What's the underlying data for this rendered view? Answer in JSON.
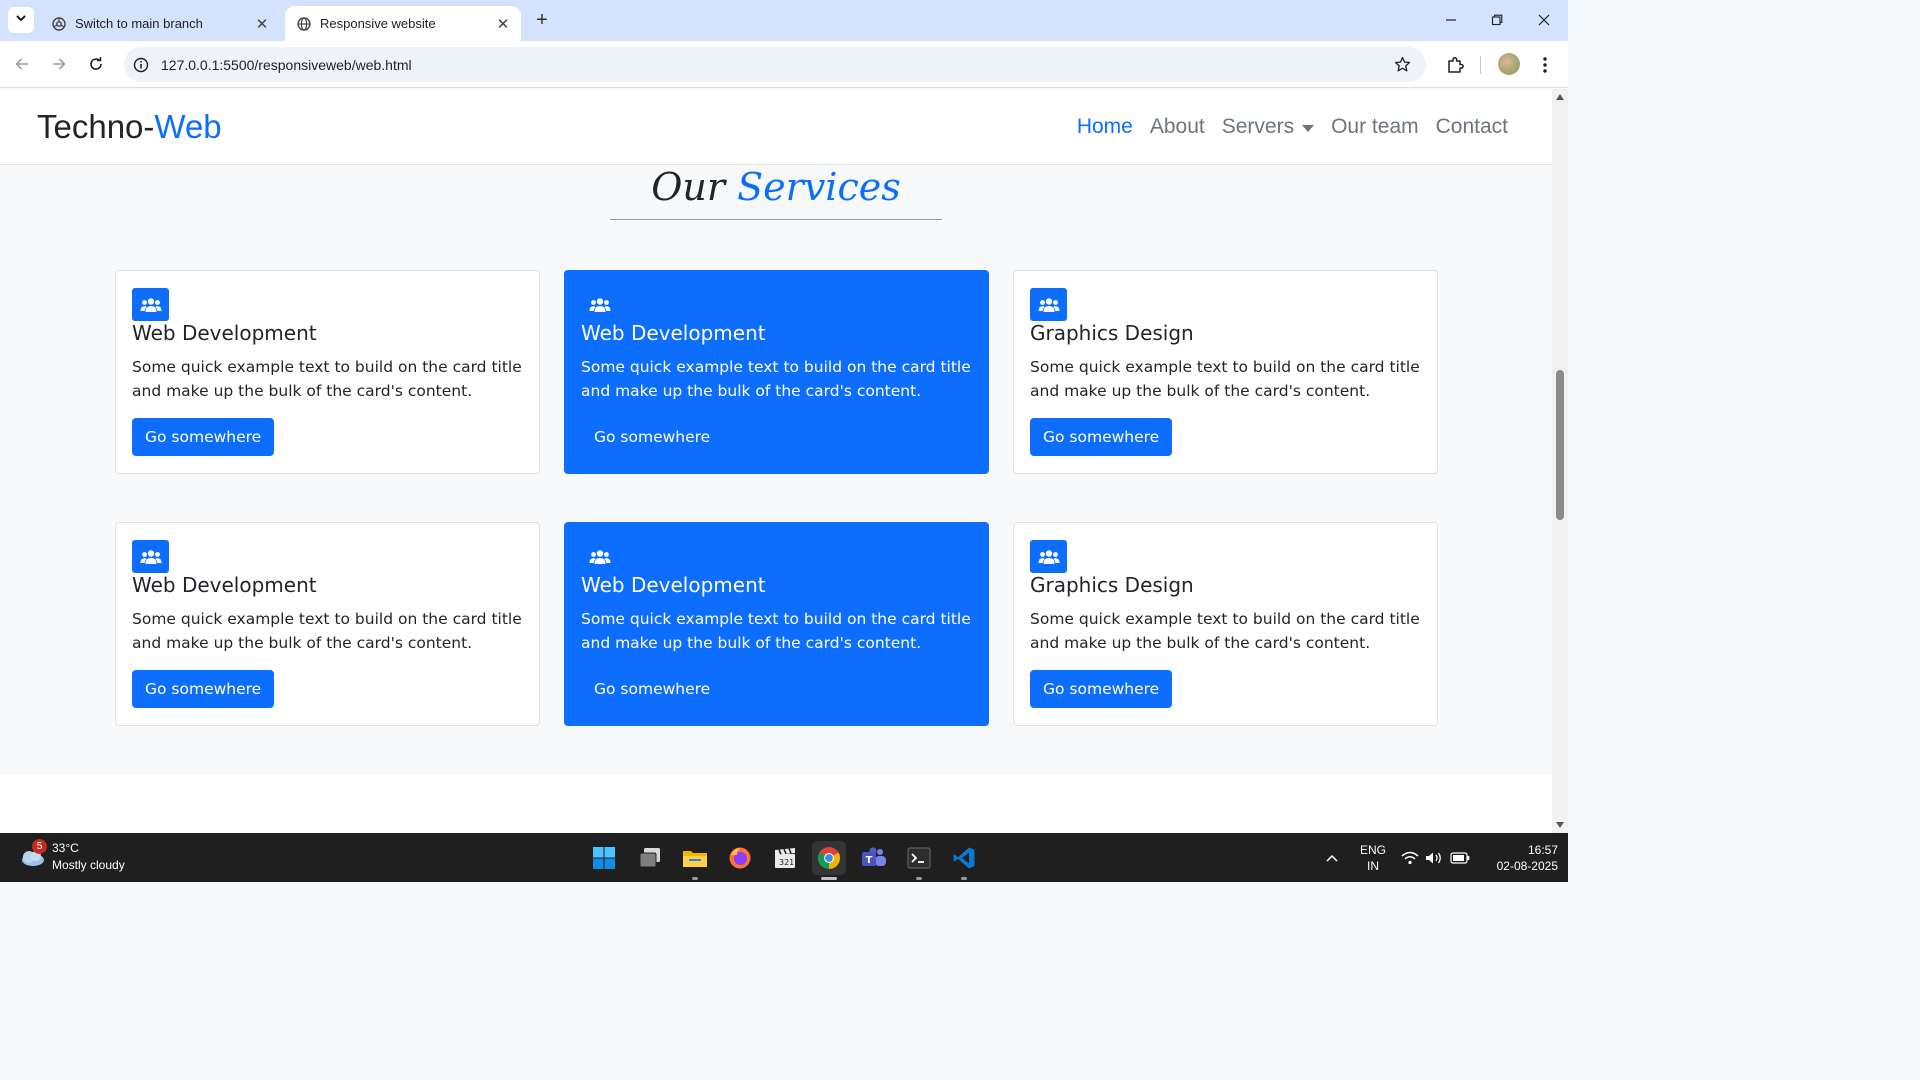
{
  "browser": {
    "tabs": [
      {
        "title": "Switch to main branch",
        "active": false
      },
      {
        "title": "Responsive website",
        "active": true
      }
    ],
    "url": "127.0.0.1:5500/responsiveweb/web.html"
  },
  "site": {
    "brand_main": "Techno-",
    "brand_accent": "Web",
    "nav": {
      "home": "Home",
      "about": "About",
      "servers": "Servers",
      "team": "Our team",
      "contact": "Contact"
    },
    "heading_main": "Our ",
    "heading_accent": "Services",
    "cards": [
      {
        "title": "Web Development",
        "text": "Some quick example text to build on the card title and make up the bulk of the card's content.",
        "button": "Go somewhere",
        "style": "white"
      },
      {
        "title": "Web Development",
        "text": "Some quick example text to build on the card title and make up the bulk of the card's content.",
        "button": "Go somewhere",
        "style": "blue"
      },
      {
        "title": "Graphics Design",
        "text": "Some quick example text to build on the card title and make up the bulk of the card's content.",
        "button": "Go somewhere",
        "style": "white"
      },
      {
        "title": "Web Development",
        "text": "Some quick example text to build on the card title and make up the bulk of the card's content.",
        "button": "Go somewhere",
        "style": "white"
      },
      {
        "title": "Web Development",
        "text": "Some quick example text to build on the card title and make up the bulk of the card's content.",
        "button": "Go somewhere",
        "style": "blue"
      },
      {
        "title": "Graphics Design",
        "text": "Some quick example text to build on the card title and make up the bulk of the card's content.",
        "button": "Go somewhere",
        "style": "white"
      }
    ]
  },
  "taskbar": {
    "weather_badge": "5",
    "weather_temp": "33°C",
    "weather_desc": "Mostly cloudy",
    "lang_line1": "ENG",
    "lang_line2": "IN",
    "time": "16:57",
    "date": "02-08-2025"
  },
  "colors": {
    "accent": "#0d6efd",
    "tab_strip": "#d3e3fd",
    "taskbar": "#1f1f1f"
  },
  "icons": [
    "chevron-down-icon",
    "chrome-icon",
    "globe-icon",
    "close-icon",
    "plus-icon",
    "minimize-icon",
    "restore-icon",
    "back-icon",
    "forward-icon",
    "reload-icon",
    "info-icon",
    "star-icon",
    "extensions-icon",
    "more-icon",
    "users-icon",
    "windows-icon",
    "file-explorer-icon",
    "firefox-icon",
    "teams-icon",
    "terminal-icon",
    "vscode-icon",
    "wifi-icon",
    "volume-icon",
    "battery-icon"
  ]
}
